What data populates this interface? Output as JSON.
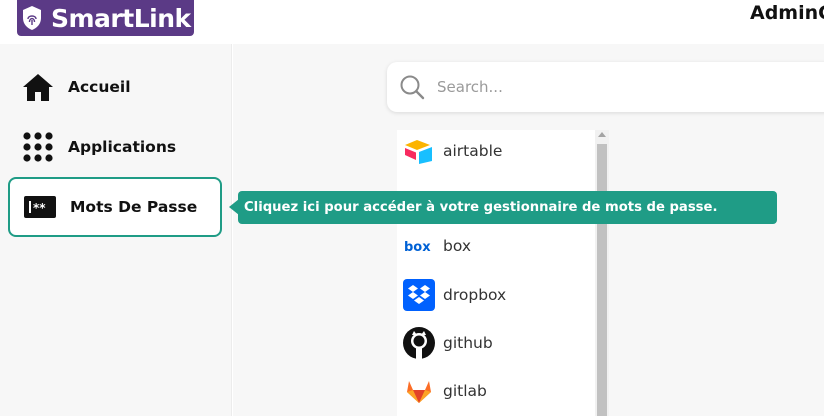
{
  "header": {
    "brand": "SmartLink",
    "user": "AdminC"
  },
  "sidebar": {
    "items": [
      {
        "label": "Accueil",
        "icon": "home-icon",
        "active": false
      },
      {
        "label": "Applications",
        "icon": "apps-grid-icon",
        "active": false
      },
      {
        "label": "Mots De Passe",
        "icon": "password-icon",
        "active": true
      }
    ]
  },
  "search": {
    "placeholder": "Search..."
  },
  "apps": [
    {
      "label": "airtable",
      "icon": "airtable-icon"
    },
    {
      "label": "box",
      "icon": "box-icon"
    },
    {
      "label": "dropbox",
      "icon": "dropbox-icon"
    },
    {
      "label": "github",
      "icon": "github-icon"
    },
    {
      "label": "gitlab",
      "icon": "gitlab-icon"
    }
  ],
  "tooltip": {
    "text": "Cliquez ici pour accéder à votre gestionnaire de mots de passe."
  },
  "colors": {
    "brand": "#5b3a86",
    "accent": "#1f9c86"
  }
}
